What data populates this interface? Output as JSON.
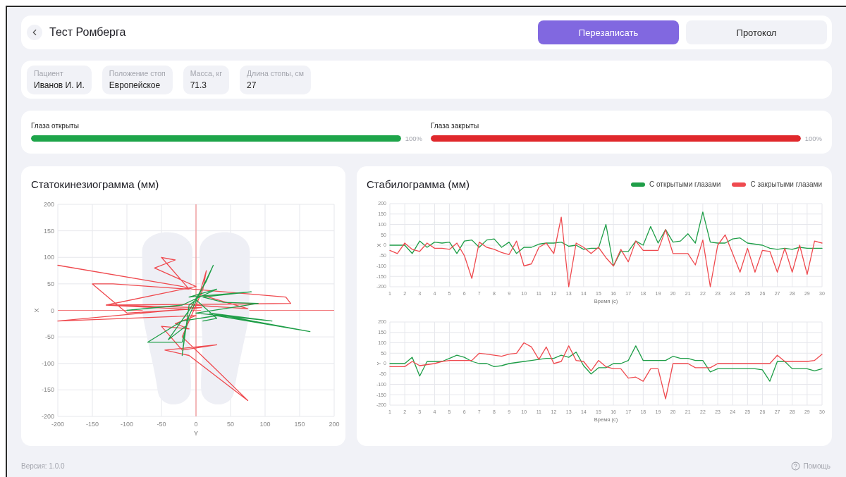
{
  "header": {
    "title": "Тест Ромберга",
    "buttons": [
      {
        "label": "Перезаписать",
        "kind": "primary"
      },
      {
        "label": "Протокол",
        "kind": "secondary"
      }
    ]
  },
  "info": [
    {
      "label": "Пациент",
      "value": "Иванов И. И."
    },
    {
      "label": "Положение стоп",
      "value": "Европейское"
    },
    {
      "label": "Масса, кг",
      "value": "71.3"
    },
    {
      "label": "Длина стопы, см",
      "value": "27"
    }
  ],
  "progress": [
    {
      "label": "Глаза открыты",
      "level": 1,
      "reading": "100%",
      "color": "#1ea54a"
    },
    {
      "label": "Глаза закрыты",
      "level": 1,
      "reading": "100%",
      "color": "#e0282c"
    }
  ],
  "statokinesiogram": {
    "title": "Статокинезиограмма (мм)",
    "chart_data": {
      "type": "line",
      "grid": true,
      "xlabel": "Y",
      "ylabel": "X",
      "xlim": [
        -200,
        200
      ],
      "ylim": [
        -200,
        200
      ],
      "xticks": [
        -200,
        -150,
        -100,
        -50,
        0,
        50,
        100,
        150,
        200
      ],
      "yticks": [
        -200,
        -150,
        -100,
        -50,
        0,
        50,
        100,
        150,
        200
      ],
      "series": [
        {
          "color": "#ef4a4f",
          "x": [
            -200,
            -20,
            -5,
            130,
            137,
            60,
            -130,
            -10,
            -100,
            -150,
            -120,
            -10,
            -50,
            -30,
            -60,
            0,
            -130,
            8,
            -200,
            0,
            -30,
            -10,
            -50,
            -20,
            30,
            -45,
            -10,
            75,
            20,
            -20,
            10,
            15,
            5,
            75,
            -5
          ],
          "values": [
            85,
            45,
            40,
            25,
            13,
            12,
            10,
            2,
            -5,
            50,
            50,
            40,
            100,
            95,
            80,
            45,
            10,
            5,
            -20,
            -10,
            -25,
            -35,
            -30,
            -75,
            -65,
            -75,
            -85,
            -170,
            -100,
            -50,
            40,
            75,
            30,
            3,
            10
          ]
        },
        {
          "color": "#1f9e48",
          "x": [
            -100,
            -20,
            30,
            -10,
            80,
            10,
            40,
            90,
            0,
            110,
            20,
            165,
            30,
            -20,
            -70,
            -20,
            -10,
            25,
            15,
            -10,
            -40,
            -15,
            -20,
            -10,
            0,
            30,
            10
          ],
          "values": [
            0,
            10,
            40,
            25,
            35,
            25,
            15,
            13,
            -5,
            -20,
            -5,
            -40,
            -10,
            -20,
            -60,
            -60,
            -10,
            85,
            55,
            0,
            -55,
            -30,
            -85,
            10,
            20,
            -15,
            -20
          ]
        }
      ]
    }
  },
  "stabilogram": {
    "title": "Стабилограмма (мм)",
    "legend": [
      {
        "label": "С открытыми глазами",
        "color": "#1f9e48"
      },
      {
        "label": "С закрытыми глазами",
        "color": "#ef4a4f"
      }
    ],
    "charts": [
      {
        "chart_data": {
          "type": "line",
          "grid": true,
          "xlabel": "Время (с)",
          "ylabel": "X",
          "xlim": [
            1,
            30
          ],
          "ylim": [
            -200,
            200
          ],
          "xticks": [
            1,
            2,
            3,
            4,
            5,
            6,
            7,
            8,
            9,
            10,
            11,
            12,
            13,
            14,
            15,
            16,
            17,
            18,
            19,
            20,
            21,
            22,
            23,
            24,
            25,
            26,
            27,
            28,
            29,
            30
          ],
          "yticks": [
            -200,
            -150,
            -100,
            -50,
            0,
            50,
            100,
            150,
            200
          ],
          "x": [
            1,
            1.5,
            2,
            2.5,
            3,
            3.5,
            4,
            4.5,
            5,
            5.5,
            6,
            6.5,
            7,
            7.5,
            8,
            8.5,
            9,
            9.5,
            10,
            10.5,
            11,
            11.5,
            12,
            12.5,
            13,
            13.5,
            14,
            14.5,
            15,
            15.5,
            16,
            16.5,
            17,
            17.5,
            18,
            18.5,
            19,
            19.5,
            20,
            20.5,
            21,
            21.5,
            22,
            22.5,
            23,
            23.5,
            24,
            24.5,
            25,
            25.5,
            26,
            26.5,
            27,
            27.5,
            28,
            28.5,
            29,
            29.5,
            30
          ],
          "series": [
            {
              "color": "#1f9e48",
              "values": [
                0,
                0,
                0,
                -40,
                20,
                -10,
                15,
                10,
                15,
                -40,
                20,
                25,
                -10,
                25,
                30,
                -10,
                15,
                -40,
                -10,
                -10,
                5,
                10,
                10,
                15,
                -5,
                0,
                -20,
                -15,
                -15,
                100,
                -100,
                -30,
                -30,
                20,
                0,
                90,
                10,
                75,
                15,
                20,
                55,
                10,
                160,
                15,
                10,
                10,
                30,
                35,
                10,
                5,
                0,
                -15,
                -20,
                -15,
                -20,
                -10,
                -15,
                -15,
                -15
              ]
            },
            {
              "color": "#ef4a4f",
              "values": [
                -25,
                -40,
                10,
                -20,
                -30,
                10,
                -15,
                -15,
                -20,
                10,
                -50,
                -160,
                15,
                -10,
                -20,
                -35,
                -45,
                20,
                -100,
                -90,
                -10,
                10,
                -40,
                135,
                -200,
                10,
                -10,
                -40,
                -10,
                -60,
                -100,
                -20,
                -80,
                20,
                -25,
                -25,
                -25,
                75,
                -40,
                -40,
                -40,
                -95,
                25,
                -200,
                0,
                50,
                -40,
                -130,
                -15,
                -130,
                -25,
                -30,
                -130,
                -15,
                -130,
                0,
                -140,
                20,
                10
              ]
            }
          ]
        }
      },
      {
        "chart_data": {
          "type": "line",
          "grid": true,
          "xlabel": "Время (с)",
          "ylabel": "Y",
          "xlim": [
            1,
            30
          ],
          "ylim": [
            -200,
            200
          ],
          "xticks": [
            1,
            2,
            3,
            4,
            5,
            6,
            7,
            8,
            9,
            10,
            11,
            12,
            13,
            14,
            15,
            16,
            17,
            18,
            19,
            20,
            21,
            22,
            23,
            24,
            25,
            26,
            27,
            28,
            29,
            30
          ],
          "yticks": [
            -200,
            -150,
            -100,
            -50,
            0,
            50,
            100,
            150,
            200
          ],
          "x": [
            1,
            1.5,
            2,
            2.5,
            3,
            3.5,
            4,
            4.5,
            5,
            5.5,
            6,
            6.5,
            7,
            7.5,
            8,
            8.5,
            9,
            9.5,
            10,
            10.5,
            11,
            11.5,
            12,
            12.5,
            13,
            13.5,
            14,
            14.5,
            15,
            15.5,
            16,
            16.5,
            17,
            17.5,
            18,
            18.5,
            19,
            19.5,
            20,
            20.5,
            21,
            21.5,
            22,
            22.5,
            23,
            23.5,
            24,
            24.5,
            25,
            25.5,
            26,
            26.5,
            27,
            27.5,
            28,
            28.5,
            29,
            29.5,
            30
          ],
          "series": [
            {
              "color": "#1f9e48",
              "values": [
                0,
                0,
                0,
                30,
                -60,
                10,
                10,
                10,
                25,
                40,
                30,
                10,
                0,
                0,
                -15,
                -10,
                0,
                5,
                10,
                15,
                20,
                25,
                25,
                40,
                30,
                55,
                -10,
                -50,
                -20,
                -20,
                0,
                0,
                15,
                85,
                15,
                15,
                15,
                15,
                35,
                25,
                25,
                15,
                15,
                -40,
                -25,
                -25,
                -25,
                -25,
                -25,
                -25,
                -30,
                -85,
                10,
                10,
                -25,
                -25,
                -25,
                -35,
                -25
              ]
            },
            {
              "color": "#ef4a4f",
              "values": [
                -15,
                -15,
                -15,
                10,
                -10,
                -5,
                0,
                10,
                15,
                15,
                15,
                15,
                50,
                45,
                40,
                35,
                45,
                50,
                100,
                80,
                20,
                80,
                0,
                10,
                85,
                15,
                10,
                -35,
                15,
                -15,
                -25,
                -25,
                -70,
                -65,
                -85,
                -25,
                -25,
                -170,
                0,
                0,
                0,
                -20,
                -20,
                -20,
                0,
                0,
                0,
                0,
                0,
                0,
                0,
                0,
                40,
                10,
                10,
                10,
                10,
                15,
                45
              ]
            }
          ]
        }
      }
    ]
  },
  "footer": {
    "version": "Версия: 1.0.0",
    "help": "Помощь"
  }
}
